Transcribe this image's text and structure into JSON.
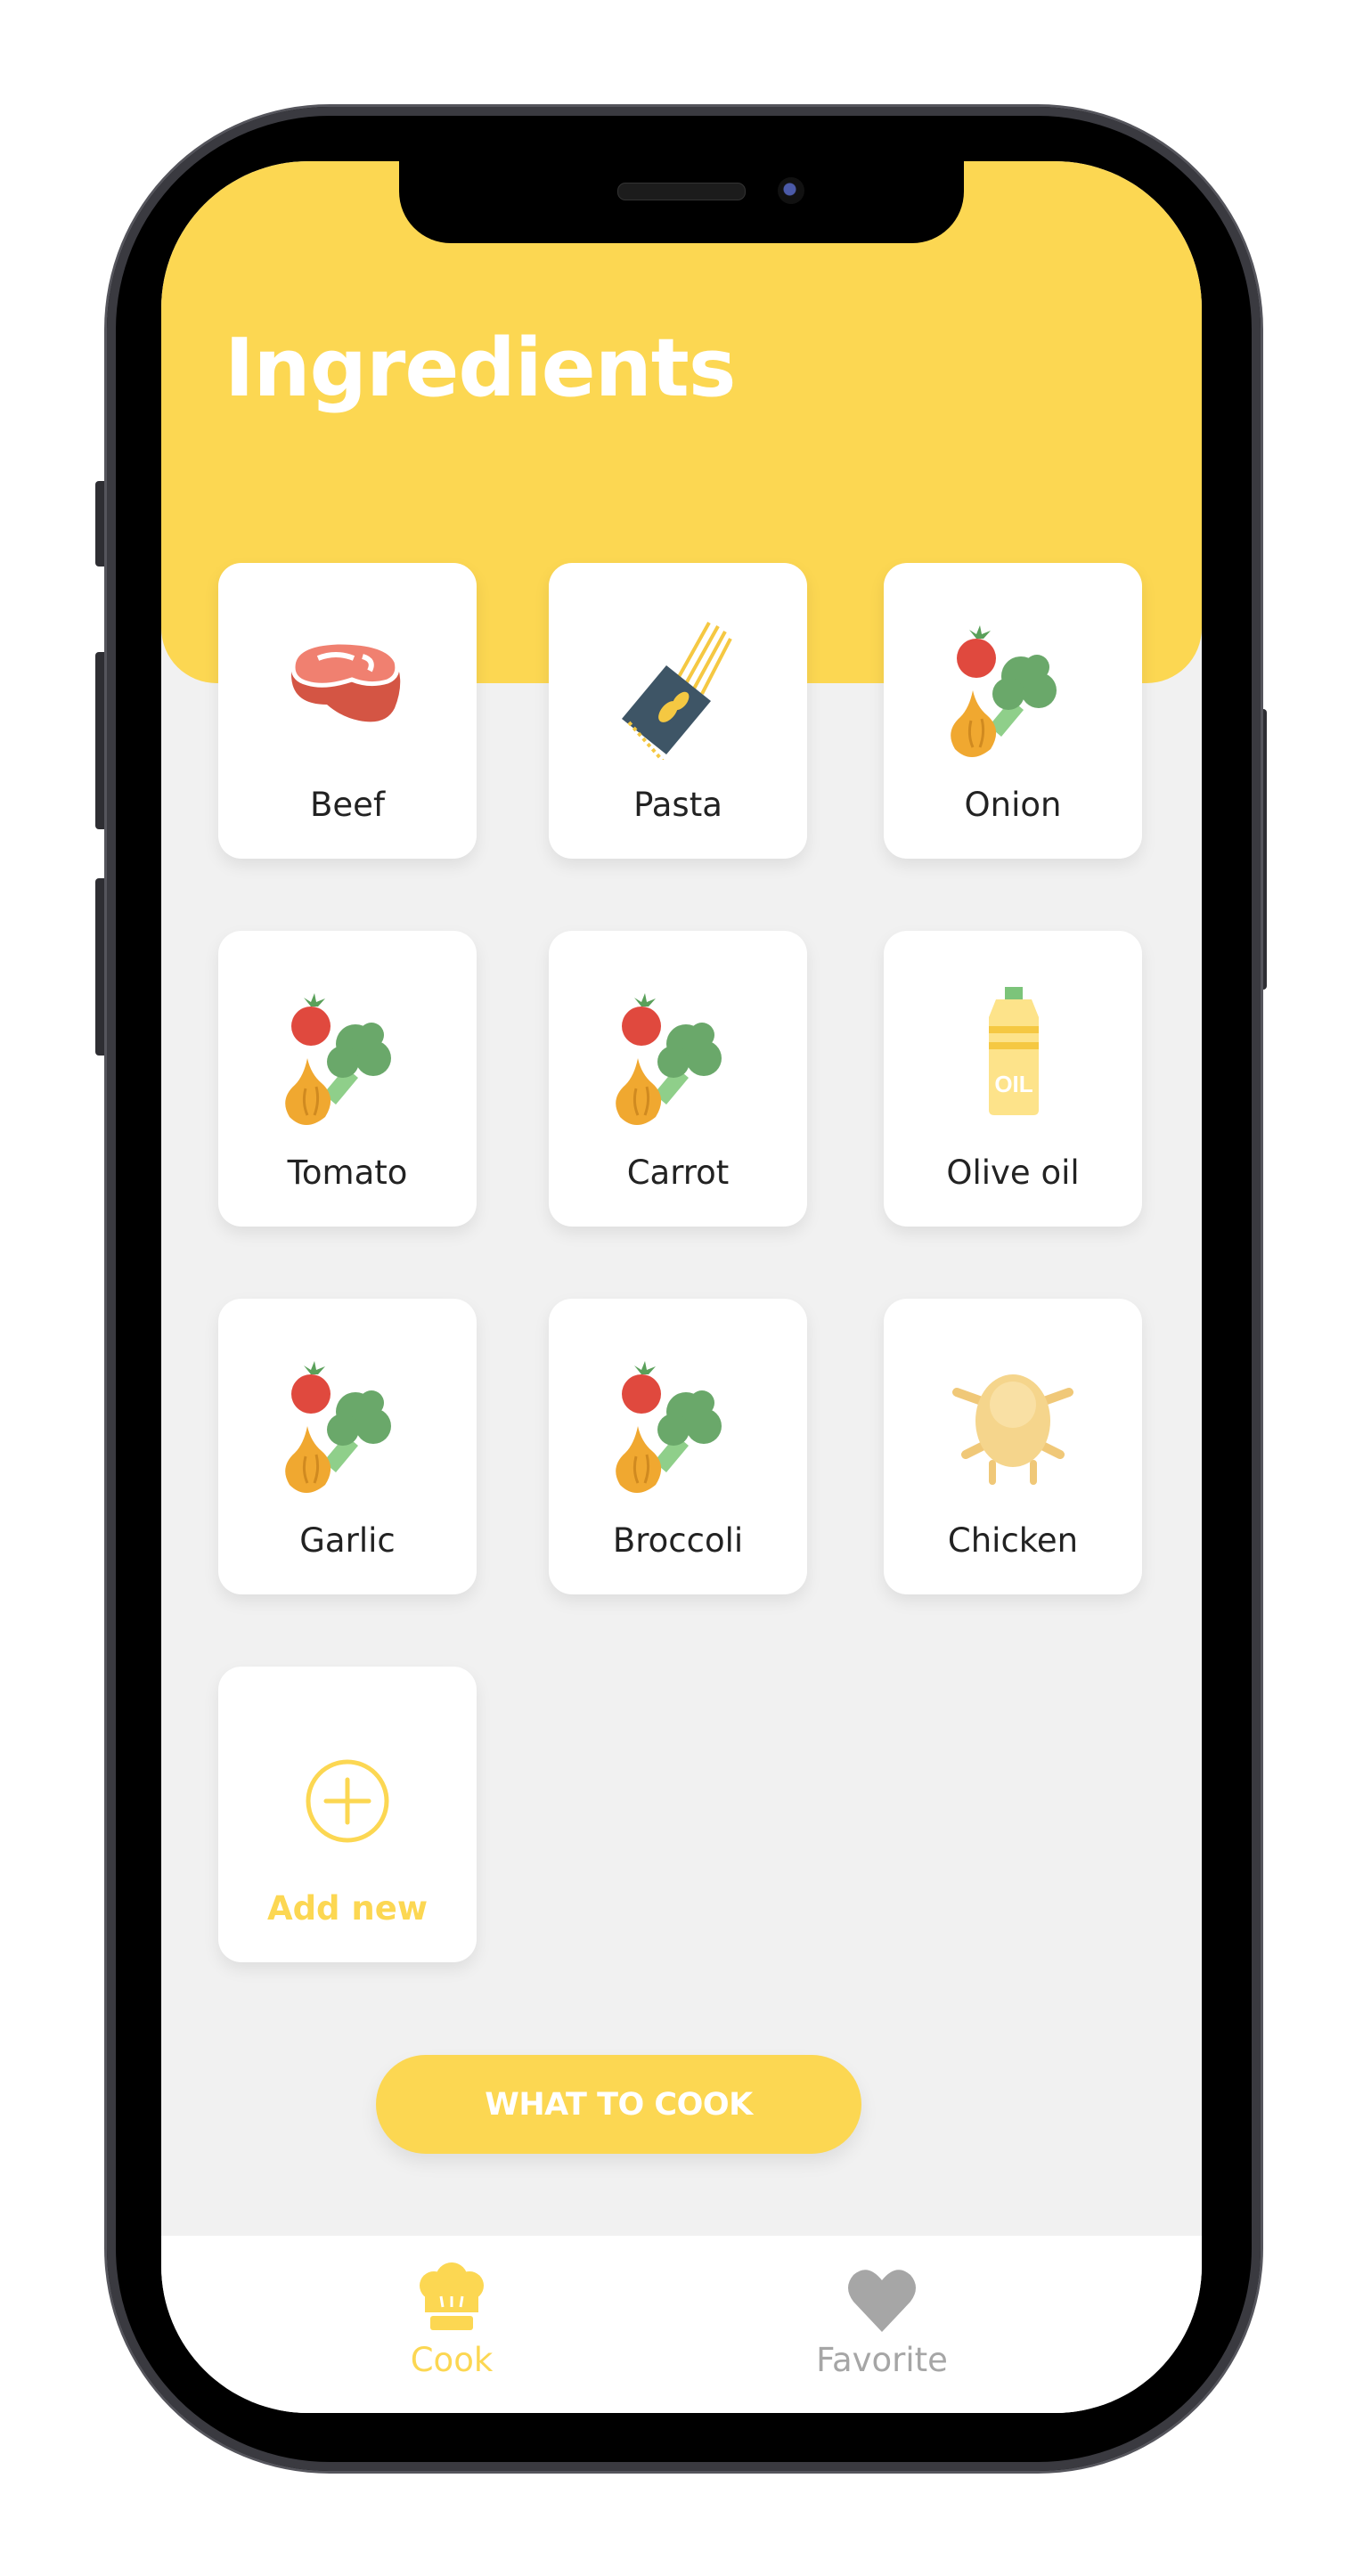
{
  "header": {
    "title": "Ingredients"
  },
  "ingredients": [
    {
      "label": "Beef",
      "icon": "steak-icon"
    },
    {
      "label": "Pasta",
      "icon": "pasta-icon"
    },
    {
      "label": "Onion",
      "icon": "vegetables-icon"
    },
    {
      "label": "Tomato",
      "icon": "vegetables-icon"
    },
    {
      "label": "Carrot",
      "icon": "vegetables-icon"
    },
    {
      "label": "Olive oil",
      "icon": "oil-bottle-icon"
    },
    {
      "label": "Garlic",
      "icon": "vegetables-icon"
    },
    {
      "label": "Broccoli",
      "icon": "vegetables-icon"
    },
    {
      "label": "Chicken",
      "icon": "chicken-icon"
    }
  ],
  "add_new": {
    "label": "Add new",
    "icon": "plus-circle-icon"
  },
  "cta": {
    "label": "WHAT TO COOK"
  },
  "nav": {
    "items": [
      {
        "label": "Cook",
        "icon": "chef-hat-icon",
        "active": true
      },
      {
        "label": "Favorite",
        "icon": "heart-icon",
        "active": false
      }
    ]
  },
  "colors": {
    "accent": "#fcd752",
    "background": "#f1f1f1",
    "inactive": "#a6a6a6"
  }
}
